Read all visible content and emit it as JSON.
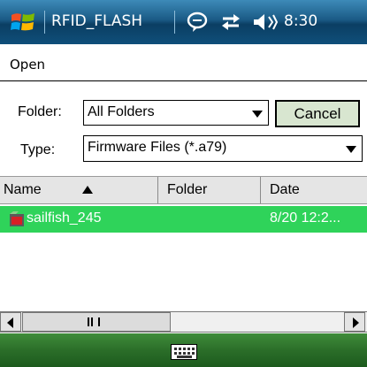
{
  "status_bar": {
    "app_title": "RFID_FLASH",
    "clock": "8:30",
    "icons": [
      "windows-start-icon",
      "message-icon",
      "sync-icon",
      "volume-icon"
    ]
  },
  "dialog": {
    "title": "Open",
    "folder_label": "Folder:",
    "folder_value": "All Folders",
    "cancel_label": "Cancel",
    "type_label": "Type:",
    "type_value": "Firmware Files (*.a79)"
  },
  "file_list": {
    "columns": [
      "Name",
      "Folder",
      "Date"
    ],
    "sort_column": "Name",
    "rows": [
      {
        "name": "sailfish_245",
        "folder": "",
        "date": "8/20 12:2..."
      }
    ]
  },
  "colors": {
    "title_bar": "#1a5a85",
    "selection": "#2fd35a",
    "bottom_bar": "#2b6e29",
    "cancel_button": "#d8e6d0"
  },
  "bottom_bar": {
    "icons": [
      "keyboard-icon"
    ]
  }
}
